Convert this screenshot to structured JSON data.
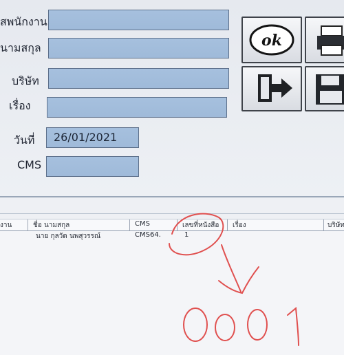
{
  "form": {
    "employee_label": "สพนักงาน",
    "name_label": "นามสกุล",
    "company_label": "บริษัท",
    "subject_label": "เรื่อง",
    "date_label": "วันที่",
    "date_value": "26/01/2021",
    "cms_label": "CMS",
    "employee_value": "",
    "name_value": "",
    "company_value": "",
    "subject_value": "",
    "cms_value": ""
  },
  "buttons": {
    "ok_label": "ok"
  },
  "grid": {
    "columns": [
      "งาน",
      "ชื่อ นามสกุล",
      "CMS",
      "เลขที่หนังสือ",
      "เรื่อง",
      "บริษัท"
    ],
    "rows": [
      {
        "employee": "",
        "name": "นาย กุลวัด นพสุวรรณ์",
        "cms": "CMS64.",
        "doc_no": "1",
        "subject": "",
        "company": ""
      }
    ]
  },
  "annotation": {
    "handwritten_text": "0001",
    "ink_color": "#e0504f"
  }
}
